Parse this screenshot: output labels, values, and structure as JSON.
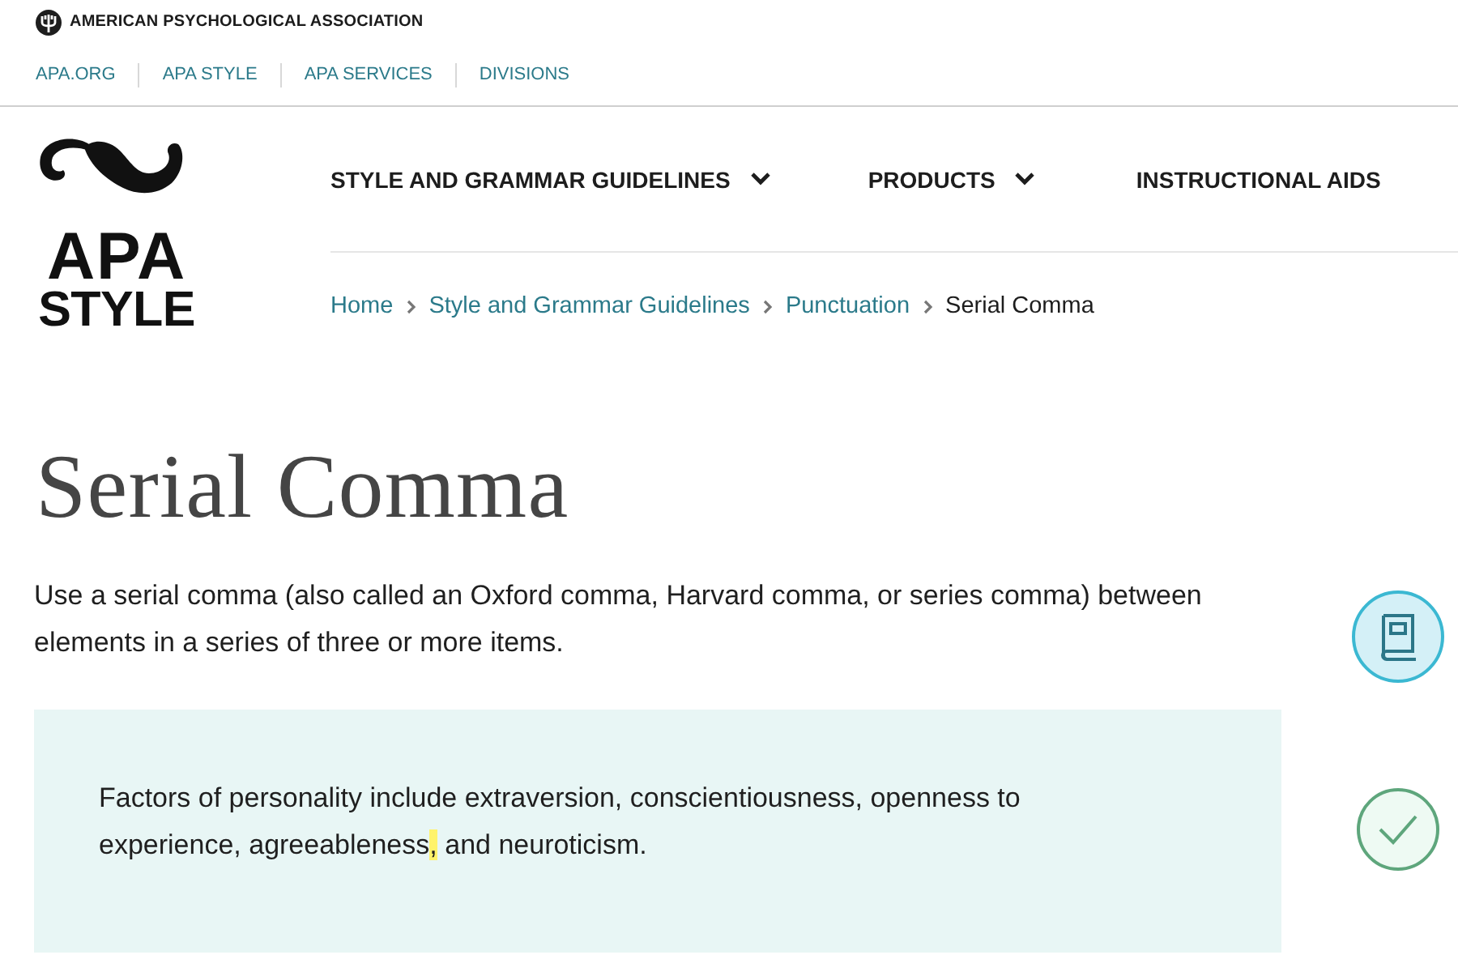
{
  "top_bar": {
    "organization": "AMERICAN PSYCHOLOGICAL ASSOCIATION",
    "links": [
      "APA.ORG",
      "APA STYLE",
      "APA SERVICES",
      "DIVISIONS"
    ]
  },
  "logo": {
    "wordmark": [
      "APA",
      "STYLE"
    ]
  },
  "nav": {
    "items": [
      {
        "label": "STYLE AND GRAMMAR GUIDELINES",
        "has_menu": true
      },
      {
        "label": "PRODUCTS",
        "has_menu": true
      },
      {
        "label": "INSTRUCTIONAL AIDS",
        "has_menu": false
      }
    ]
  },
  "breadcrumb": [
    {
      "label": "Home",
      "current": false
    },
    {
      "label": "Style and Grammar Guidelines",
      "current": false
    },
    {
      "label": "Punctuation",
      "current": false
    },
    {
      "label": "Serial Comma",
      "current": true
    }
  ],
  "title": "Serial Comma",
  "intro": "Use a serial comma (also called an Oxford comma, Harvard comma, or series comma) between elements in a series of three or more items.",
  "example": {
    "segments": [
      {
        "text": "Factors of personality include extraversion, conscientiousness, openness to experience, agreeableness",
        "highlighted": false
      },
      {
        "text": ",",
        "highlighted": true
      },
      {
        "text": " and neuroticism.",
        "highlighted": false
      }
    ]
  },
  "side_icons": [
    {
      "kind": "book"
    },
    {
      "kind": "check"
    }
  ]
}
